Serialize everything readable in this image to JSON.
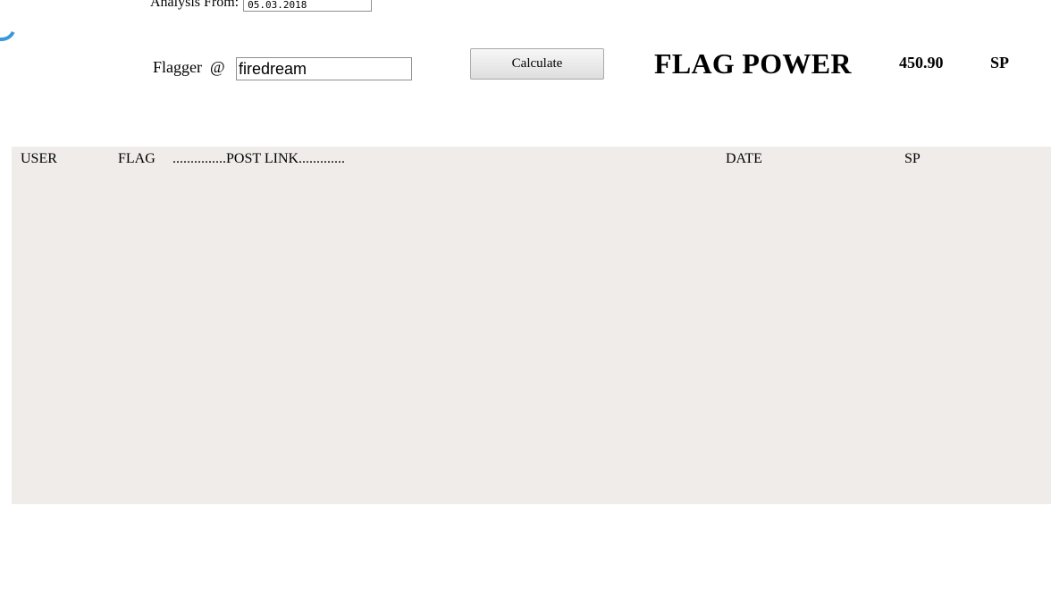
{
  "analysis": {
    "label": "Analysis From:",
    "date_value": "05.03.2018"
  },
  "flagger": {
    "label": "Flagger  @",
    "value": "firedream"
  },
  "calculate_label": "Calculate",
  "flag_power": {
    "title": "FLAG POWER",
    "value": "450.90",
    "unit": "SP"
  },
  "table": {
    "columns": [
      "USER",
      "FLAG",
      "...............POST LINK.............",
      "DATE",
      "SP"
    ]
  },
  "colors": {
    "panel_background": "#f0ecea",
    "spinner": "#3b98d8"
  }
}
